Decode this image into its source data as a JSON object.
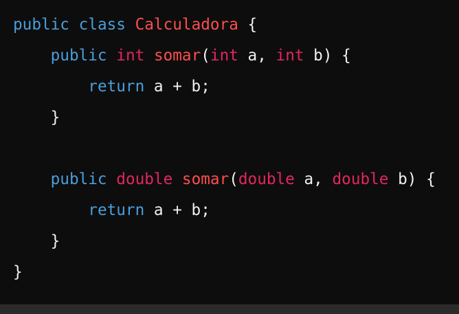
{
  "colors": {
    "background": "#0d0d0d",
    "keyword": "#4a9edb",
    "type": "#e2265f",
    "identifier": "#ff4d4d",
    "plain": "#f0f0f0"
  },
  "code": {
    "lines": [
      [
        {
          "t": "public",
          "c": "kw"
        },
        {
          "t": " ",
          "c": "plain"
        },
        {
          "t": "class",
          "c": "kw"
        },
        {
          "t": " ",
          "c": "plain"
        },
        {
          "t": "Calculadora",
          "c": "cls"
        },
        {
          "t": " {",
          "c": "plain"
        }
      ],
      [
        {
          "t": "    ",
          "c": "plain"
        },
        {
          "t": "public",
          "c": "kw"
        },
        {
          "t": " ",
          "c": "plain"
        },
        {
          "t": "int",
          "c": "ty"
        },
        {
          "t": " ",
          "c": "plain"
        },
        {
          "t": "somar",
          "c": "fn"
        },
        {
          "t": "(",
          "c": "plain"
        },
        {
          "t": "int",
          "c": "ty"
        },
        {
          "t": " a, ",
          "c": "plain"
        },
        {
          "t": "int",
          "c": "ty"
        },
        {
          "t": " b) {",
          "c": "plain"
        }
      ],
      [
        {
          "t": "        ",
          "c": "plain"
        },
        {
          "t": "return",
          "c": "kw"
        },
        {
          "t": " a + b;",
          "c": "plain"
        }
      ],
      [
        {
          "t": "    }",
          "c": "plain"
        }
      ],
      [],
      [
        {
          "t": "    ",
          "c": "plain"
        },
        {
          "t": "public",
          "c": "kw"
        },
        {
          "t": " ",
          "c": "plain"
        },
        {
          "t": "double",
          "c": "ty"
        },
        {
          "t": " ",
          "c": "plain"
        },
        {
          "t": "somar",
          "c": "fn"
        },
        {
          "t": "(",
          "c": "plain"
        },
        {
          "t": "double",
          "c": "ty"
        },
        {
          "t": " a, ",
          "c": "plain"
        },
        {
          "t": "double",
          "c": "ty"
        },
        {
          "t": " b) {",
          "c": "plain"
        }
      ],
      [
        {
          "t": "        ",
          "c": "plain"
        },
        {
          "t": "return",
          "c": "kw"
        },
        {
          "t": " a + b;",
          "c": "plain"
        }
      ],
      [
        {
          "t": "    }",
          "c": "plain"
        }
      ],
      [
        {
          "t": "}",
          "c": "plain"
        }
      ]
    ]
  }
}
